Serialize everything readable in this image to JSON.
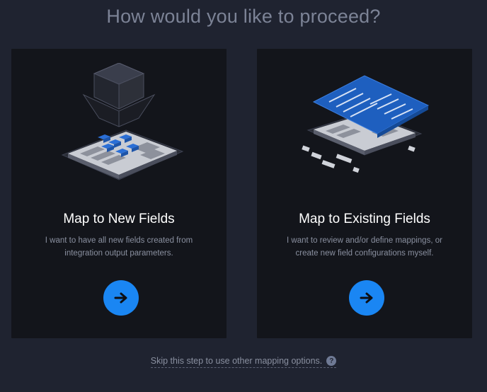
{
  "heading": "How would you like to proceed?",
  "cards": [
    {
      "title": "Map to New Fields",
      "description": "I want to have all new fields created from integration output parameters.",
      "illustration": "new-fields-illustration",
      "button_icon": "arrow-right-icon"
    },
    {
      "title": "Map to Existing Fields",
      "description": "I want to review and/or define mappings, or create new field configurations myself.",
      "illustration": "existing-fields-illustration",
      "button_icon": "arrow-right-icon"
    }
  ],
  "skip": {
    "label": "Skip this step to use other mapping options.",
    "help_icon": "question-mark-icon",
    "help_glyph": "?"
  },
  "colors": {
    "background": "#1f2330",
    "card": "#13151b",
    "accent": "#1a86f3",
    "heading": "#7c8396",
    "text_muted": "#8a90a0"
  }
}
